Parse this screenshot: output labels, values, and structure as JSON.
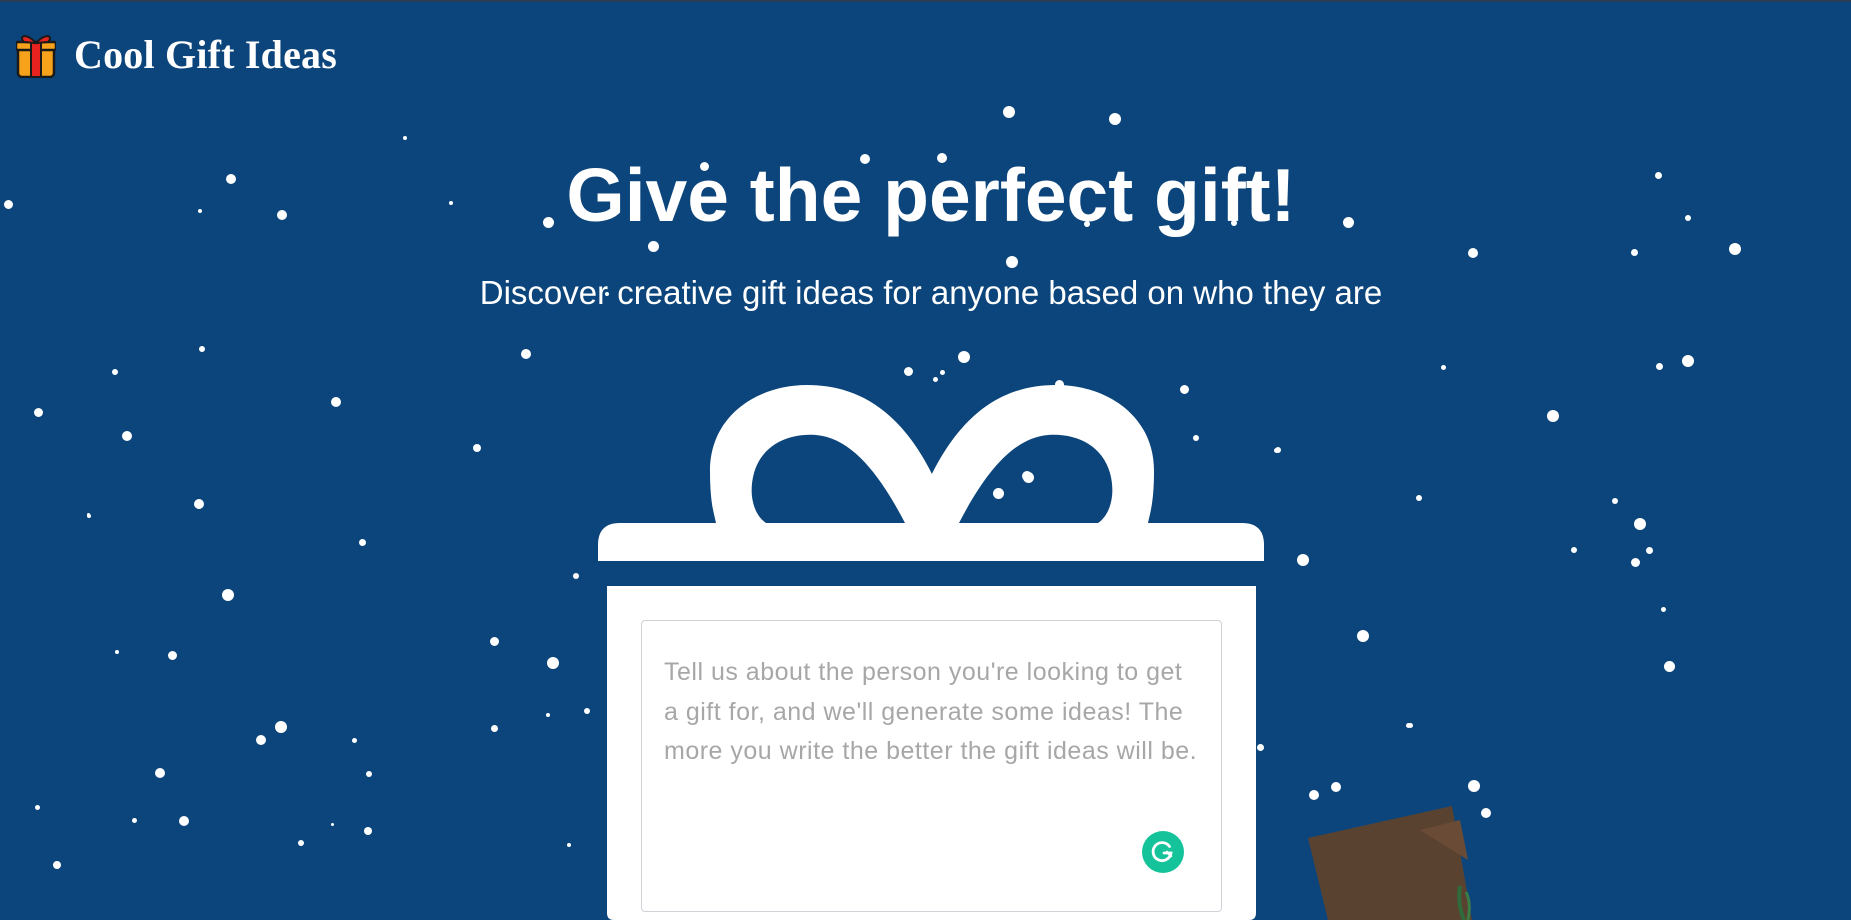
{
  "app": {
    "brand_icon": "gift-emoji-icon",
    "title": "Cool Gift Ideas"
  },
  "hero": {
    "title": "Give the perfect gift!",
    "subtitle": "Discover creative gift ideas for anyone based on who they are"
  },
  "form": {
    "description_placeholder": "Tell us about the person you're looking to get a gift for, and we'll generate some ideas! The more you write the better the gift ideas will be.",
    "description_value": "",
    "assistant_icon": "grammarly-icon"
  },
  "colors": {
    "background": "#0c457b",
    "gift_white": "#ffffff",
    "grammarly_green": "#15c39a",
    "brand_gift_orange": "#f7a21b",
    "brand_gift_red": "#e8231f"
  }
}
